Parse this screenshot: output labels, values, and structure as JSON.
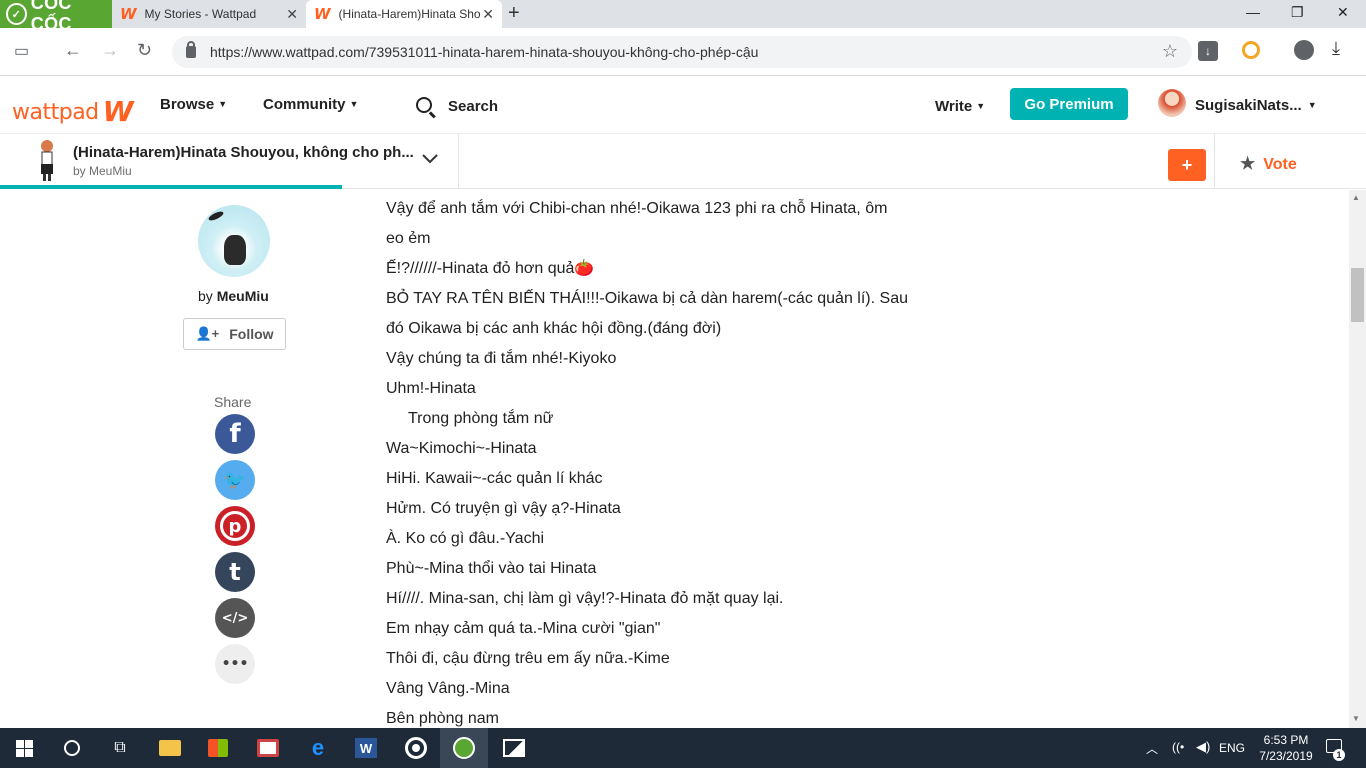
{
  "browser": {
    "brand_name": "CỐC CỐC",
    "tabs": [
      {
        "title": "My Stories - Wattpad"
      },
      {
        "title": "(Hinata-Harem)Hinata Sho"
      }
    ],
    "url": "https://www.wattpad.com/739531011-hinata-harem-hinata-shouyou-không-cho-phép-cậu"
  },
  "header": {
    "logo": "wattpad",
    "nav": [
      {
        "label": "Browse"
      },
      {
        "label": "Community"
      }
    ],
    "search_label": "Search",
    "write_label": "Write",
    "premium_label": "Go Premium",
    "username": "SugisakiNats..."
  },
  "story": {
    "title": "(Hinata-Harem)Hinata Shouyou, không cho ph...",
    "author_line": "by MeuMiu",
    "add_label": "+",
    "vote_label": "Vote",
    "reading_progress": 0.25
  },
  "author": {
    "by": "by",
    "name": "MeuMiu",
    "follow_label": "Follow"
  },
  "share": {
    "label": "Share",
    "buttons": [
      {
        "name": "facebook",
        "glyph": "f",
        "color": "#3b5998"
      },
      {
        "name": "twitter",
        "glyph": "🐦",
        "color": "#55acee"
      },
      {
        "name": "pinterest",
        "glyph": "p",
        "color": "#cb2027"
      },
      {
        "name": "tumblr",
        "glyph": "t",
        "color": "#35465c"
      },
      {
        "name": "embed",
        "glyph": "</>",
        "color": "#555555"
      },
      {
        "name": "more",
        "glyph": "•••",
        "color": "#eeeeee"
      }
    ]
  },
  "article": {
    "lines": [
      "Vậy để anh tắm với Chibi-chan nhé!-Oikawa 123 phi ra chỗ Hinata, ôm",
      "eo ẻm",
      "Ế!?//////-Hinata đỏ hơn quả🍅",
      "BỎ TAY RA TÊN BIẾN THÁI!!!-Oikawa bị cả dàn harem(-các quản lí). Sau",
      "đó Oikawa bị các anh khác hội đồng.(đáng đời)",
      "Vậy chúng ta đi tắm nhé!-Kiyoko",
      "Uhm!-Hinata",
      "Trong phòng tắm nữ",
      "Wa~Kimochi~-Hinata",
      "HiHi. Kawaii~-các quản lí khác",
      "Hửm. Có truyện gì vậy ạ?-Hinata",
      "À. Ko có gì đâu.-Yachi",
      "Phù~-Mina thổi vào tai Hinata",
      "Hí////. Mina-san, chị làm gì vậy!?-Hinata đỏ mặt quay lại.",
      "Em nhạy cảm quá ta.-Mina cười \"gian\"",
      "Thôi đi, cậu đừng trêu em ấy nữa.-Kime",
      "Vâng Vâng.-Mina",
      "Bên phòng nam"
    ]
  },
  "taskbar": {
    "language": "ENG",
    "time": "6:53 PM",
    "date": "7/23/2019",
    "notification_count": "1"
  }
}
